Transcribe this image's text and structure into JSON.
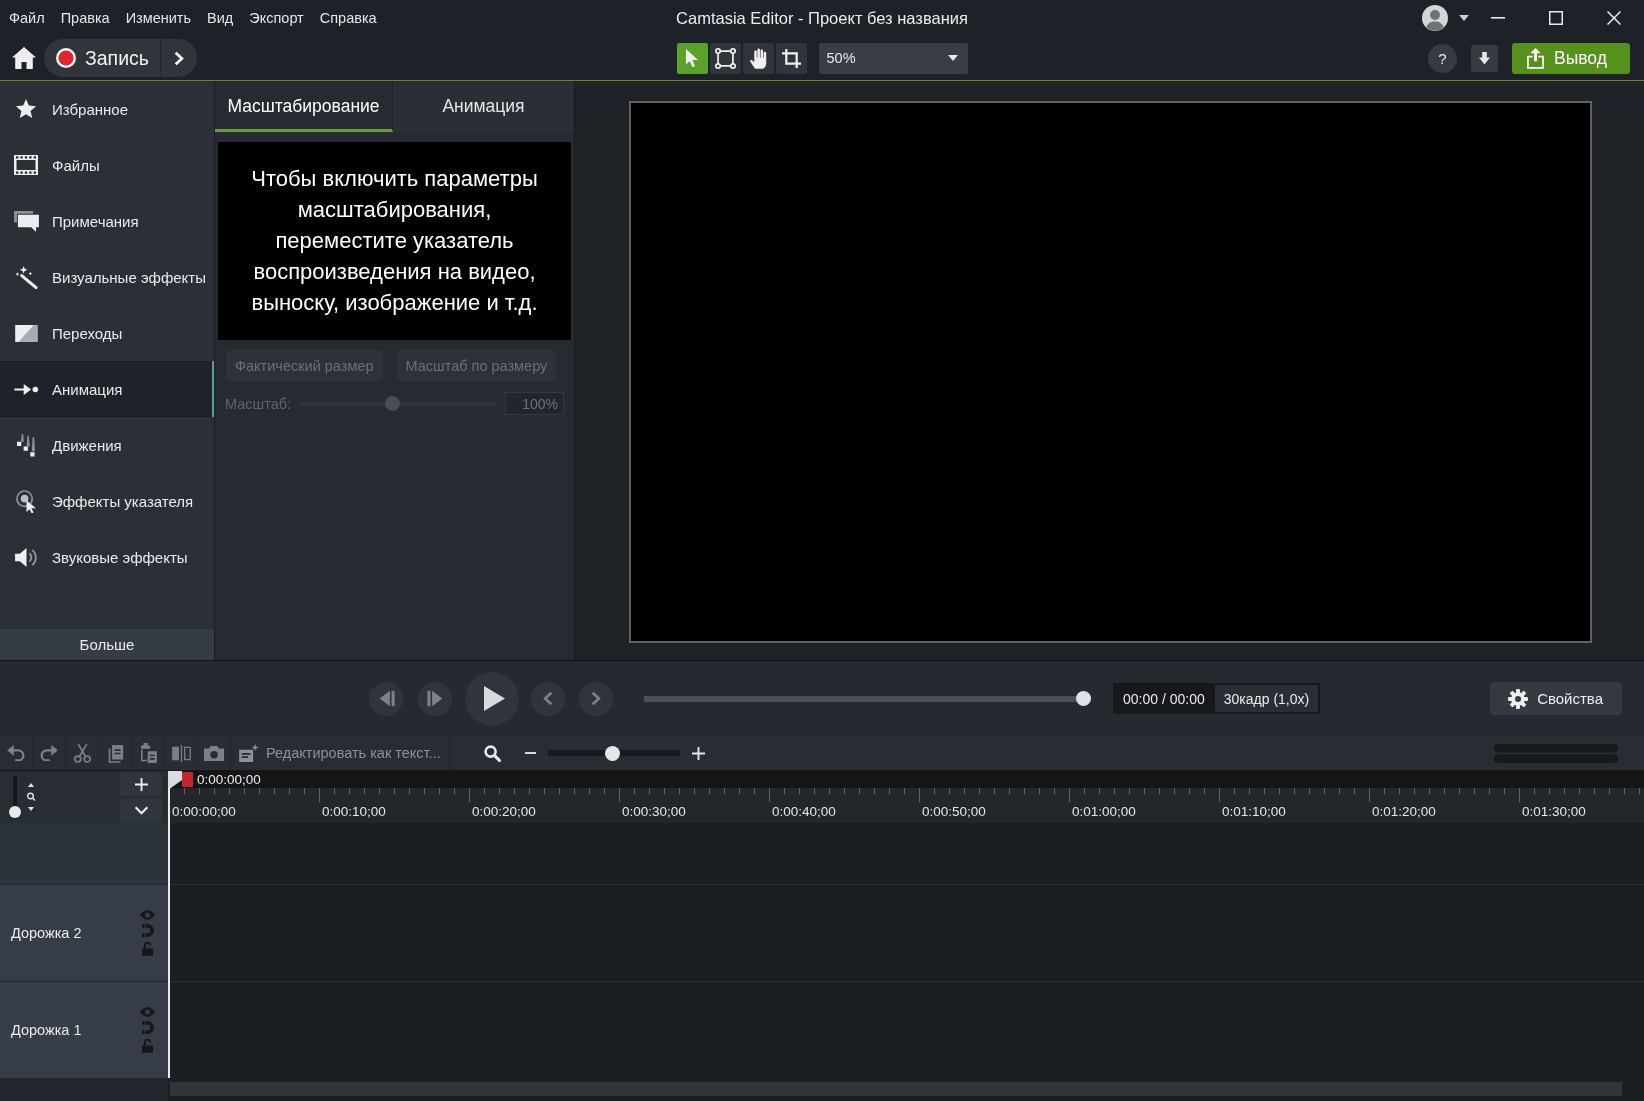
{
  "menu_bar": [
    "Файл",
    "Правка",
    "Изменить",
    "Вид",
    "Экспорт",
    "Справка"
  ],
  "window": {
    "title": "Camtasia Editor - Проект без названия"
  },
  "toolbar": {
    "record_button": "Запись",
    "tools": [
      {
        "kind": "pointer",
        "selected": true
      },
      {
        "kind": "transform",
        "selected": false
      },
      {
        "kind": "pan",
        "selected": false
      },
      {
        "kind": "crop",
        "selected": false
      }
    ],
    "zoom_select": "50%",
    "help_button": "?",
    "export_button": "Вывод"
  },
  "sidebar": {
    "items": [
      {
        "kind": "star",
        "label": "Избранное",
        "selected": false
      },
      {
        "kind": "film",
        "label": "Файлы",
        "selected": false
      },
      {
        "kind": "callout",
        "label": "Примечания",
        "selected": false
      },
      {
        "kind": "wand",
        "label": "Визуальные эффекты",
        "selected": false
      },
      {
        "kind": "transition",
        "label": "Переходы",
        "selected": false
      },
      {
        "kind": "animation",
        "label": "Анимация",
        "selected": true
      },
      {
        "kind": "behavior",
        "label": "Движения",
        "selected": false
      },
      {
        "kind": "cursor",
        "label": "Эффекты указателя",
        "selected": false
      },
      {
        "kind": "audio",
        "label": "Звуковые эффекты",
        "selected": false
      }
    ],
    "more_button": "Больше"
  },
  "panel": {
    "tabs": [
      {
        "label": "Масштабирование",
        "selected": true
      },
      {
        "label": "Анимация",
        "selected": false
      }
    ],
    "message": "Чтобы включить параметры масштабирования, переместите указатель воспроизведения на видео, выноску, изображение и т.д.",
    "buttons": [
      {
        "label": "Фактический размер",
        "disabled": true
      },
      {
        "label": "Масштаб по размеру",
        "disabled": true
      }
    ],
    "scale": {
      "label": "Масштаб:",
      "level": 0.47,
      "value": "100%",
      "disabled": true
    }
  },
  "playback": {
    "controls": [
      {
        "kind": "step-back",
        "disabled": true
      },
      {
        "kind": "step-forward",
        "disabled": true
      },
      {
        "kind": "play",
        "disabled": false
      },
      {
        "kind": "previous",
        "disabled": true
      },
      {
        "kind": "next",
        "disabled": true
      }
    ],
    "progress": {
      "level": 1
    },
    "time": "00:00 / 00:00",
    "frame_rate": "30кадр (1,0x)",
    "properties_button": "Свойства"
  },
  "timeline_toolbar": {
    "tools": [
      {
        "kind": "undo",
        "disabled": true
      },
      {
        "kind": "redo",
        "disabled": true
      },
      {
        "kind": "cut",
        "disabled": true
      },
      {
        "kind": "copy",
        "disabled": true
      },
      {
        "kind": "paste",
        "disabled": true
      },
      {
        "kind": "split",
        "disabled": true
      },
      {
        "kind": "snapshot",
        "disabled": true
      }
    ],
    "edit_as_text": {
      "label": "Редактировать как текст...",
      "disabled": true
    },
    "zoom": {
      "level": 0.49
    }
  },
  "timeline": {
    "height_slider": {
      "level": 0
    },
    "playhead_time": "0:00:00;00",
    "ruler_labels": [
      "0:00:00;00",
      "0:00:10;00",
      "0:00:20;00",
      "0:00:30;00",
      "0:00:40;00",
      "0:00:50;00",
      "0:01:00;00",
      "0:01:10;00",
      "0:01:20;00",
      "0:01:30;00"
    ],
    "tracks": [
      {
        "name": "Дорожка 2",
        "visible": true,
        "locked": false
      },
      {
        "name": "Дорожка 1",
        "visible": true,
        "locked": false
      }
    ]
  }
}
